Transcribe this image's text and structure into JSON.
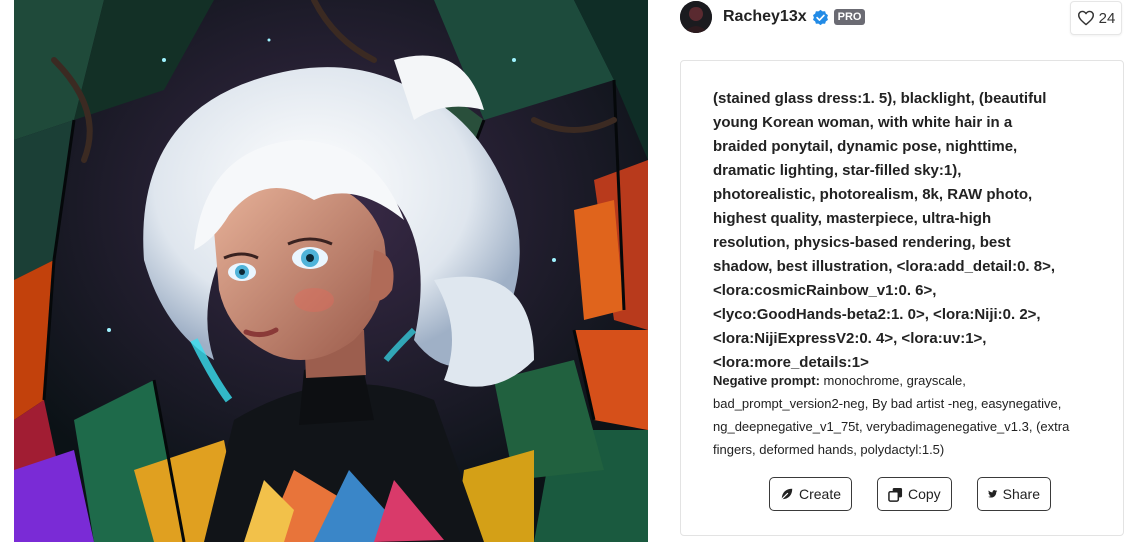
{
  "artwork": {
    "icon": "stained-glass-portrait-image"
  },
  "user": {
    "name": "Rachey13x",
    "badge": "PRO",
    "verified_icon": "verified-check-icon",
    "avatar_icon": "avatar-image"
  },
  "likes": {
    "count": "24",
    "icon": "heart-icon"
  },
  "prompt": {
    "text": "(stained glass dress:1. 5), blacklight, (beautiful young Korean woman, with white hair in a braided ponytail, dynamic pose, nighttime, dramatic lighting, star-filled sky:1), photorealistic, photorealism, 8k, RAW photo, highest quality, masterpiece, ultra-high resolution, physics-based rendering, best shadow, best illustration, <lora:add_detail:0. 8>, <lora:cosmicRainbow_v1:0. 6>, <lyco:GoodHands-beta2:1. 0>, <lora:Niji:0. 2>, <lora:NijiExpressV2:0. 4>, <lora:uv:1>, <lora:more_details:1>"
  },
  "negative": {
    "label": "Negative prompt:",
    "text": "monochrome, grayscale, bad_prompt_version2-neg, By bad artist -neg, easynegative, ng_deepnegative_v1_75t, verybadimagenegative_v1.3, (extra fingers, deformed hands, polydactyl:1.5)"
  },
  "actions": {
    "create_label": "Create",
    "copy_label": "Copy",
    "share_label": "Share"
  },
  "colors": {
    "badge_bg": "#6b6b73",
    "verified_blue": "#228be6",
    "text": "#222222"
  }
}
